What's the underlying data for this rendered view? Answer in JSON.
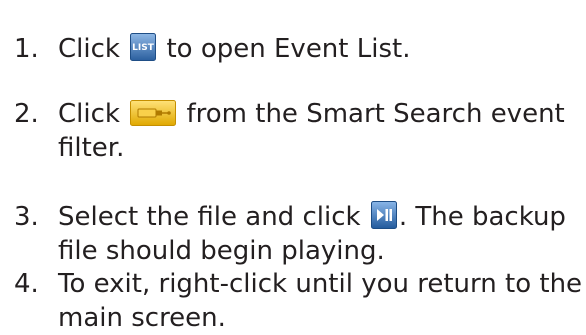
{
  "steps": [
    {
      "number": "1.",
      "before": "Click",
      "icon": "list-button-icon",
      "after": "to open Event List.",
      "continuation": ""
    },
    {
      "number": "2.",
      "before": "Click",
      "icon": "usb-filter-button-icon",
      "after": "from the Smart Search event",
      "continuation": "filter."
    },
    {
      "number": "3.",
      "before": "Select the file and click",
      "icon": "play-pause-button-icon",
      "after": ". The backup",
      "continuation": "file should begin playing."
    },
    {
      "number": "4.",
      "before": "To exit, right-click until you return to the",
      "icon": "",
      "after": "",
      "continuation": "main screen."
    }
  ],
  "icons": {
    "list_label": "LIST",
    "list_color": "#3a73b8",
    "usb_color": "#f2c21b",
    "play_color": "#2f6fb5"
  }
}
